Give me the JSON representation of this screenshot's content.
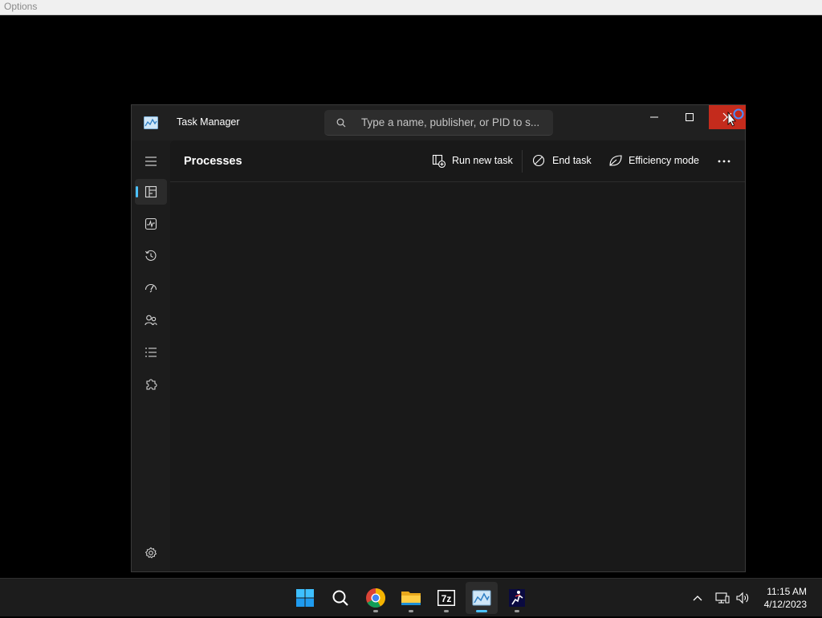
{
  "options_bar": {
    "label": "Options"
  },
  "window": {
    "title": "Task Manager",
    "search": {
      "placeholder": "Type a name, publisher, or PID to s..."
    }
  },
  "nav": {
    "items": [
      {
        "name": "processes",
        "icon": "processes-icon",
        "active": true
      },
      {
        "name": "performance",
        "icon": "performance-icon"
      },
      {
        "name": "app-history",
        "icon": "history-icon"
      },
      {
        "name": "startup-apps",
        "icon": "startup-icon"
      },
      {
        "name": "users",
        "icon": "users-icon"
      },
      {
        "name": "details",
        "icon": "details-list-icon"
      },
      {
        "name": "services",
        "icon": "services-puzzle-icon"
      }
    ],
    "settings_icon": "gear-icon"
  },
  "toolbar": {
    "page_title": "Processes",
    "run_new_task": "Run new task",
    "end_task": "End task",
    "efficiency_mode": "Efficiency mode"
  },
  "taskbar": {
    "apps": [
      "start",
      "search",
      "chrome",
      "file-explorer",
      "7-zip",
      "task-manager",
      "app"
    ],
    "time": "11:15 AM",
    "date": "4/12/2023"
  },
  "colors": {
    "accent": "#4cc2ff",
    "close_red": "#c42b1c",
    "window_bg": "#1c1c1c"
  }
}
